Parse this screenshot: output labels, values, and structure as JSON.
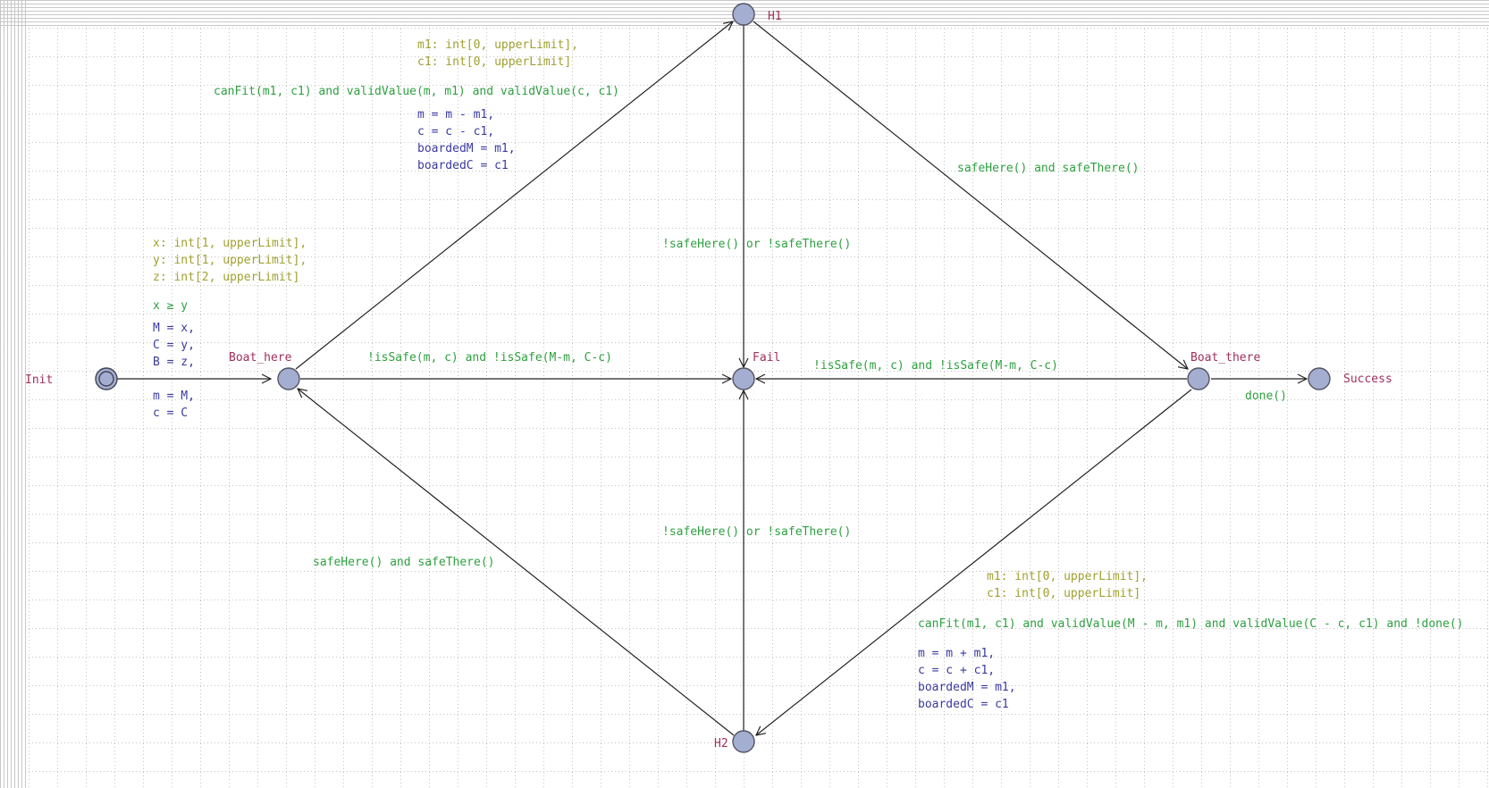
{
  "colors": {
    "location_fill": "#a3aed0",
    "location_stroke": "#555566",
    "edge": "#222222",
    "location_name": "#a0305a",
    "select": "#a0a030",
    "guard": "#2ea040",
    "update": "#3a3aa0"
  },
  "locations": {
    "init": "Init",
    "boat_here": "Boat_here",
    "h1": "H1",
    "fail": "Fail",
    "boat_there": "Boat_there",
    "success": "Success",
    "h2": "H2"
  },
  "edges": {
    "init_to_boat_here": {
      "select": [
        "x: int[1, upperLimit],",
        "y: int[1, upperLimit],",
        "z: int[2, upperLimit]"
      ],
      "guard": "x ≥ y",
      "update": [
        "M = x,",
        "C = y,",
        "B = z,",
        "",
        "m = M,",
        "c = C"
      ]
    },
    "boat_here_to_h1": {
      "select": [
        "m1: int[0, upperLimit],",
        "c1: int[0, upperLimit]"
      ],
      "guard": "canFit(m1, c1) and validValue(m, m1) and validValue(c, c1)",
      "update": [
        "m = m - m1,",
        "c = c - c1,",
        "boardedM = m1,",
        "boardedC = c1"
      ]
    },
    "h1_to_boat_there": {
      "guard": "safeHere() and safeThere()"
    },
    "h1_to_fail": {
      "guard": "!safeHere() or !safeThere()"
    },
    "boat_here_to_fail": {
      "guard": "!isSafe(m, c) and !isSafe(M-m, C-c)"
    },
    "boat_there_to_fail": {
      "guard": "!isSafe(m, c) and !isSafe(M-m, C-c)"
    },
    "boat_there_to_success": {
      "guard": "done()"
    },
    "h2_to_fail": {
      "guard": "!safeHere() or !safeThere()"
    },
    "h2_to_boat_here": {
      "guard": "safeHere() and safeThere()"
    },
    "boat_there_to_h2": {
      "select": [
        "m1: int[0, upperLimit],",
        "c1: int[0, upperLimit]"
      ],
      "guard": "canFit(m1, c1) and validValue(M - m, m1) and validValue(C - c, c1) and !done()",
      "update": [
        "m = m + m1,",
        "c = c + c1,",
        "boardedM = m1,",
        "boardedC = c1"
      ]
    }
  }
}
